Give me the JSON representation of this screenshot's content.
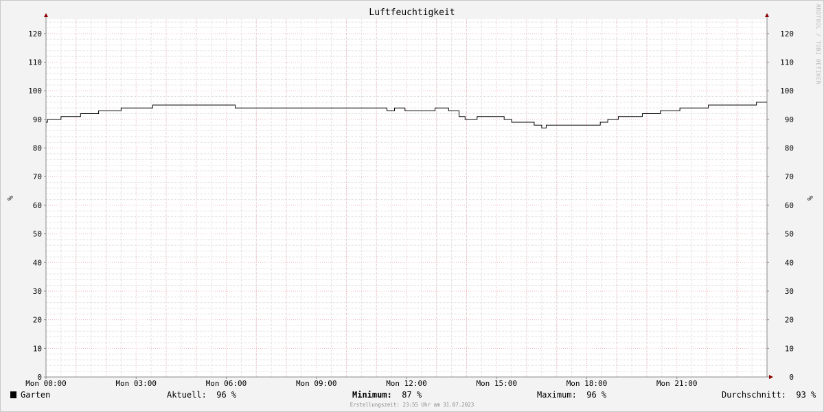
{
  "title": "Luftfeuchtigkeit",
  "watermark": "RRDTOOL / TOBI OETIKER",
  "footer": "Erstellungszeit: 23:55 Uhr am 31.07.2023",
  "legend": {
    "series_name": "Garten",
    "current_label": "Aktuell:",
    "current_value": "96 %",
    "min_label": "Minimum:",
    "min_value": "87 %",
    "max_label": "Maximum:",
    "max_value": "96 %",
    "avg_label": "Durchschnitt:",
    "avg_value": "93 %"
  },
  "colors": {
    "background": "#f3f3f3",
    "plot_background": "#ffffff",
    "minor_grid": "#dcdcdc",
    "major_grid": "#f4b8c0",
    "axis": "#888888",
    "arrow": "#8b0000",
    "series": "#000000"
  },
  "chart_data": {
    "type": "line",
    "title": "Luftfeuchtigkeit",
    "ylabel": "%",
    "ylabel_right": "%",
    "ylim": [
      0,
      125
    ],
    "yticks": [
      0,
      10,
      20,
      30,
      40,
      50,
      60,
      70,
      80,
      90,
      100,
      110,
      120
    ],
    "xlim_hours": [
      0,
      24
    ],
    "xticks": [
      {
        "hour": 0,
        "label": "Mon 00:00"
      },
      {
        "hour": 3,
        "label": "Mon 03:00"
      },
      {
        "hour": 6,
        "label": "Mon 06:00"
      },
      {
        "hour": 9,
        "label": "Mon 09:00"
      },
      {
        "hour": 12,
        "label": "Mon 12:00"
      },
      {
        "hour": 15,
        "label": "Mon 15:00"
      },
      {
        "hour": 18,
        "label": "Mon 18:00"
      },
      {
        "hour": 21,
        "label": "Mon 21:00"
      }
    ],
    "grid": true,
    "series": [
      {
        "name": "Garten",
        "step": true,
        "x_hours": [
          0.0,
          0.05,
          0.5,
          1.15,
          1.75,
          2.5,
          3.55,
          6.3,
          11.35,
          11.6,
          11.95,
          12.95,
          13.4,
          13.75,
          13.95,
          14.35,
          15.25,
          15.5,
          16.25,
          16.5,
          16.65,
          16.95,
          18.45,
          18.7,
          19.05,
          19.85,
          20.45,
          21.1,
          22.05,
          23.65,
          24.0
        ],
        "values": [
          89,
          90,
          91,
          92,
          93,
          94,
          95,
          94,
          93,
          94,
          93,
          94,
          93,
          91,
          90,
          91,
          90,
          89,
          88,
          87,
          88,
          88,
          89,
          90,
          91,
          92,
          93,
          94,
          95,
          96,
          96
        ]
      }
    ]
  }
}
